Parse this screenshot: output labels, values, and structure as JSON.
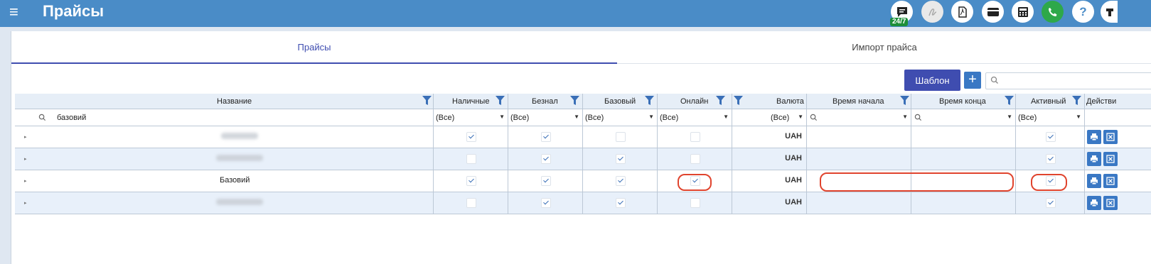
{
  "header": {
    "menu_glyph": "≡",
    "title": "Прайсы",
    "chat_badge": "24/7",
    "icons": [
      "chat-icon",
      "signature-icon",
      "pdf-icon",
      "card-icon",
      "calculator-icon",
      "phone-icon",
      "help-icon"
    ]
  },
  "tabs": [
    {
      "label": "Прайсы",
      "active": true
    },
    {
      "label": "Импорт прайса",
      "active": false
    }
  ],
  "toolbar": {
    "template_label": "Шаблон",
    "add_label": "+",
    "search_placeholder": ""
  },
  "grid": {
    "columns": [
      "Название",
      "Наличные",
      "Безнал",
      "Базовый",
      "Онлайн",
      "Валюта",
      "Время начала",
      "Время конца",
      "Активный",
      "Действи"
    ],
    "filters": {
      "name": "базовий",
      "all": "(Все)"
    },
    "rows": [
      {
        "name": "",
        "nal": true,
        "beznal": true,
        "base": false,
        "online": false,
        "currency": "UAH",
        "start": "",
        "end": "",
        "active": true
      },
      {
        "name": "",
        "nal": false,
        "beznal": true,
        "base": true,
        "online": false,
        "currency": "UAH",
        "start": "",
        "end": "",
        "active": true
      },
      {
        "name": "Базовий",
        "nal": true,
        "beznal": true,
        "base": true,
        "online": true,
        "currency": "UAH",
        "start": "",
        "end": "",
        "active": true
      },
      {
        "name": "",
        "nal": false,
        "beznal": true,
        "base": true,
        "online": false,
        "currency": "UAH",
        "start": "",
        "end": "",
        "active": true
      }
    ]
  },
  "colors": {
    "topbar": "#4a8cc7",
    "accent": "#3f4db0",
    "highlight": "#e0442e"
  }
}
